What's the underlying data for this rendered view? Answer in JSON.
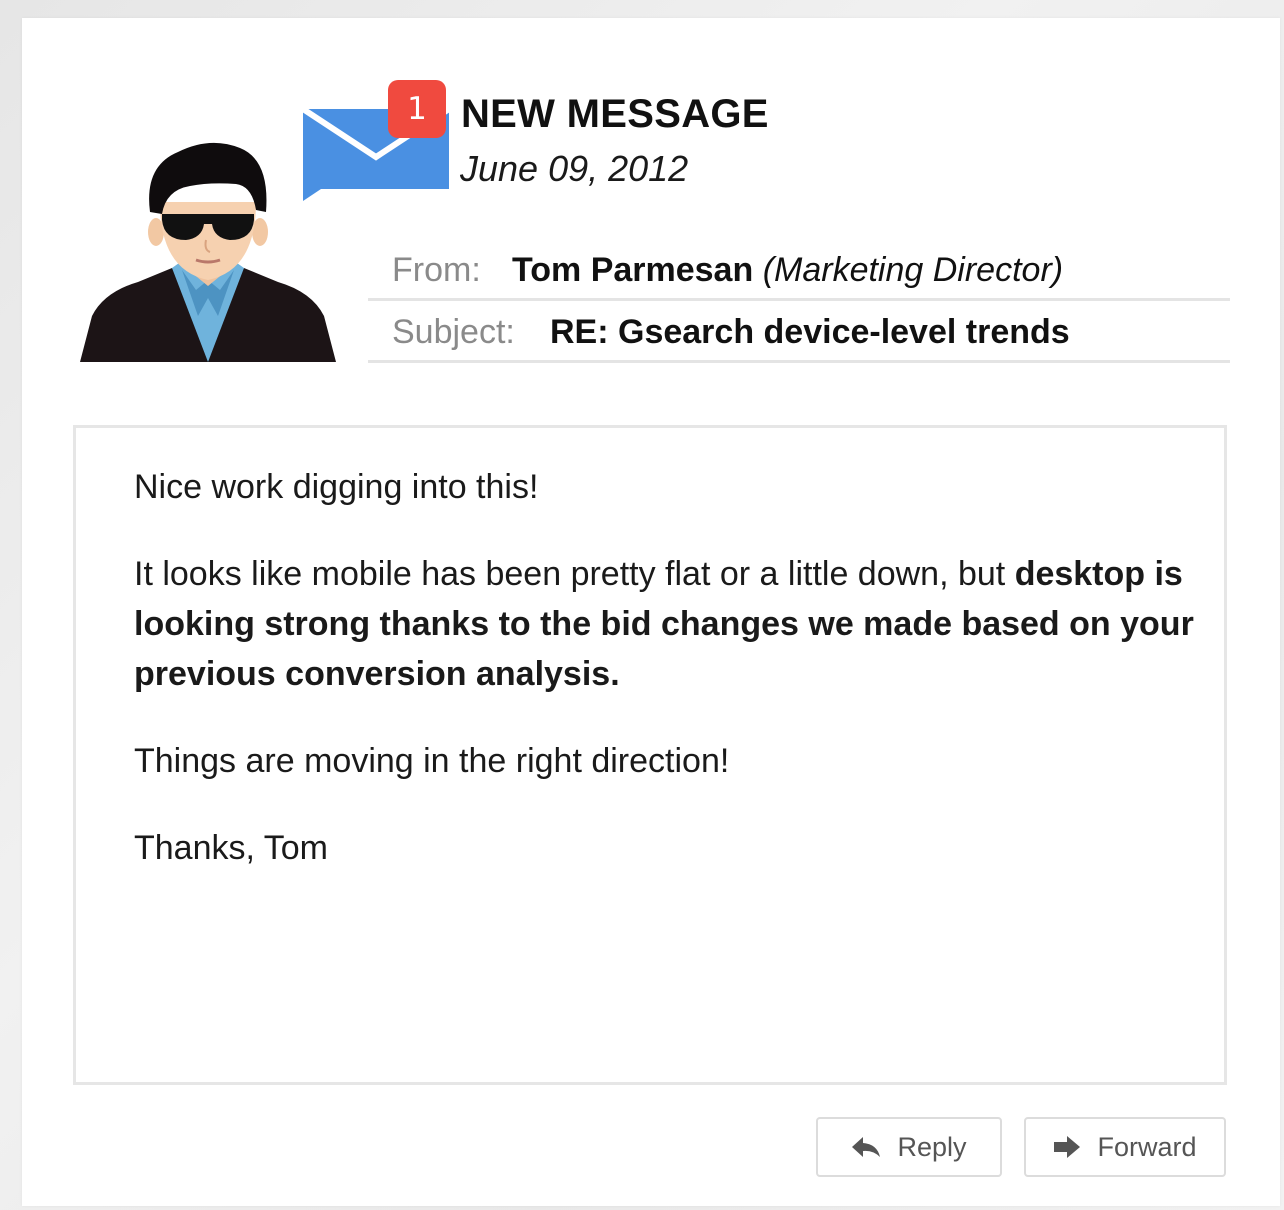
{
  "header": {
    "badge_count": "1",
    "title": "NEW MESSAGE",
    "date": "June 09, 2012"
  },
  "from": {
    "label": "From:",
    "name": "Tom Parmesan",
    "role": "(Marketing Director)"
  },
  "subject": {
    "label": "Subject:",
    "value": "RE: Gsearch device-level trends"
  },
  "body": {
    "para1": "Nice work digging into this!",
    "para2_plain": "It looks like mobile has been pretty flat or a little down, but ",
    "para2_bold": "desktop is looking strong thanks to the bid changes we made based on your previous conversion analysis.",
    "para3": "Things are moving in the right direction!",
    "para4": "Thanks, Tom"
  },
  "actions": {
    "reply_label": "Reply",
    "forward_label": "Forward"
  },
  "icons": {
    "mail": "envelope-chat-icon",
    "reply": "reply-arrow-icon",
    "forward": "forward-arrow-icon",
    "avatar": "man-with-sunglasses-avatar"
  },
  "colors": {
    "badge": "#f04a3f",
    "envelope": "#4a90e2",
    "text": "#111111",
    "label": "#8a8a8a"
  }
}
